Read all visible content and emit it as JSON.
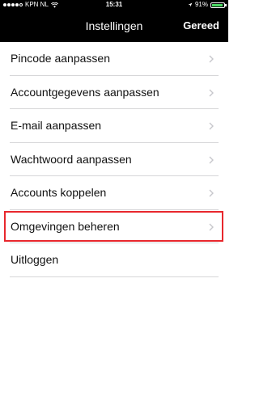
{
  "status_bar": {
    "carrier": "KPN NL",
    "time": "15:31",
    "battery_percent_text": "91%",
    "battery_level": 0.91
  },
  "nav": {
    "title": "Instellingen",
    "done_label": "Gereed"
  },
  "menu": {
    "items": [
      {
        "label": "Pincode aanpassen"
      },
      {
        "label": "Accountgegevens aanpassen"
      },
      {
        "label": "E-mail aanpassen"
      },
      {
        "label": "Wachtwoord aanpassen"
      },
      {
        "label": "Accounts koppelen"
      },
      {
        "label": "Omgevingen beheren"
      },
      {
        "label": "Uitloggen"
      }
    ],
    "highlight_color": "#e8272d"
  }
}
